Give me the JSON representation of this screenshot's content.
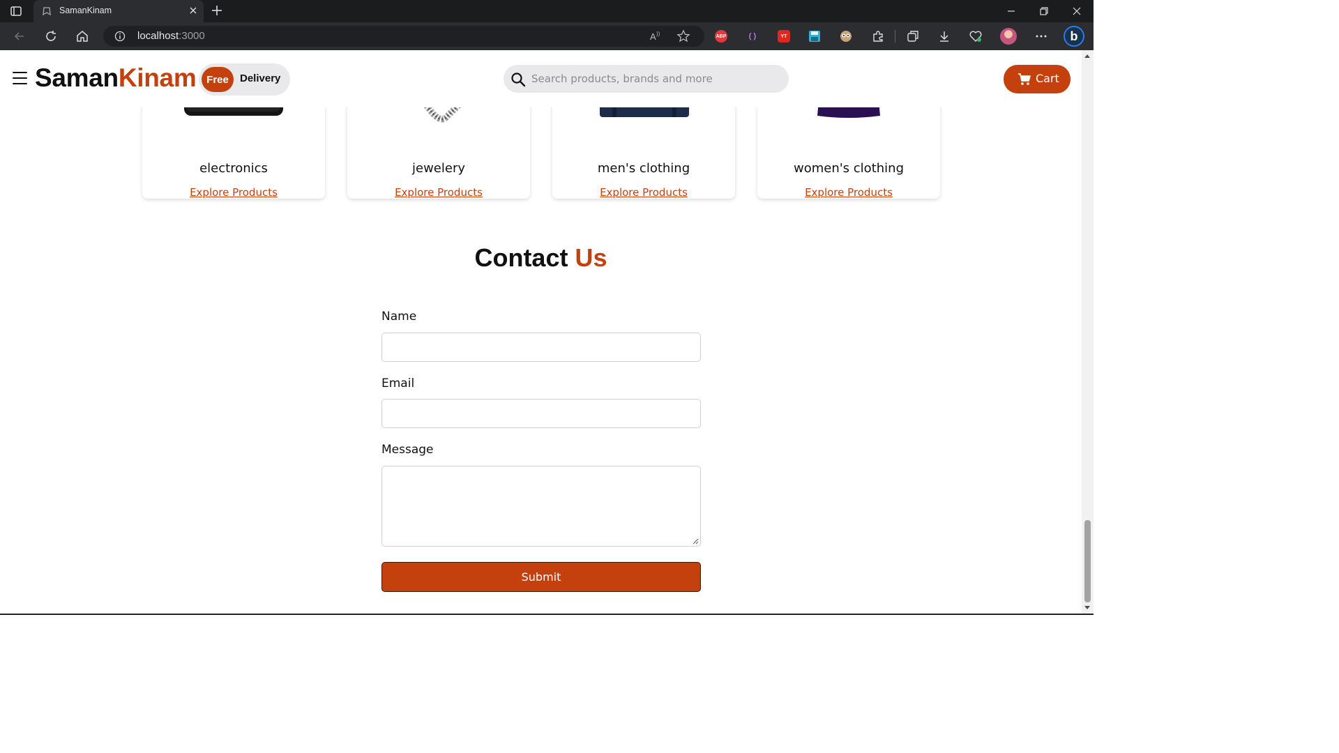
{
  "browser": {
    "tab_title": "SamanKinam",
    "url_host": "localhost",
    "url_port": ":3000",
    "icons": [
      "tab-actions-icon",
      "new-tab-icon",
      "minimize-icon",
      "restore-icon",
      "close-window-icon",
      "back-icon",
      "refresh-icon",
      "home-icon",
      "site-info-icon",
      "read-aloud-icon",
      "favorite-star-icon",
      "extensions-icon",
      "collections-icon",
      "downloads-icon",
      "performance-icon",
      "more-icon",
      "bing-copilot-icon"
    ],
    "extensions": [
      {
        "name": "adblock-plus-icon",
        "label": "ABP",
        "color": "#e03a3e"
      },
      {
        "name": "extension-purple-icon",
        "label": "( )",
        "color": "#9b51e0"
      },
      {
        "name": "extension-red-icon",
        "label": "YT",
        "color": "#e0271f"
      },
      {
        "name": "save-extension-icon",
        "label": "",
        "color": "#3aaed8"
      },
      {
        "name": "extension-face-icon",
        "label": "",
        "color": "#c9a27a"
      }
    ]
  },
  "navbar": {
    "brand_part1": "Saman",
    "brand_part2": "Kinam",
    "badge_free": "Free",
    "badge_delivery": "Delivery",
    "search_placeholder": "Search products, brands and more",
    "cart_label": "Cart",
    "accent_color": "#c4410e"
  },
  "categories": [
    {
      "name": "electronics",
      "link": "Explore Products"
    },
    {
      "name": "jewelery",
      "link": "Explore Products"
    },
    {
      "name": "men's clothing",
      "link": "Explore Products"
    },
    {
      "name": "women's clothing",
      "link": "Explore Products"
    }
  ],
  "contact": {
    "title_part1": "Contact",
    "title_part2": "Us",
    "name_label": "Name",
    "email_label": "Email",
    "message_label": "Message",
    "name_value": "",
    "email_value": "",
    "message_value": "",
    "submit_label": "Submit"
  }
}
